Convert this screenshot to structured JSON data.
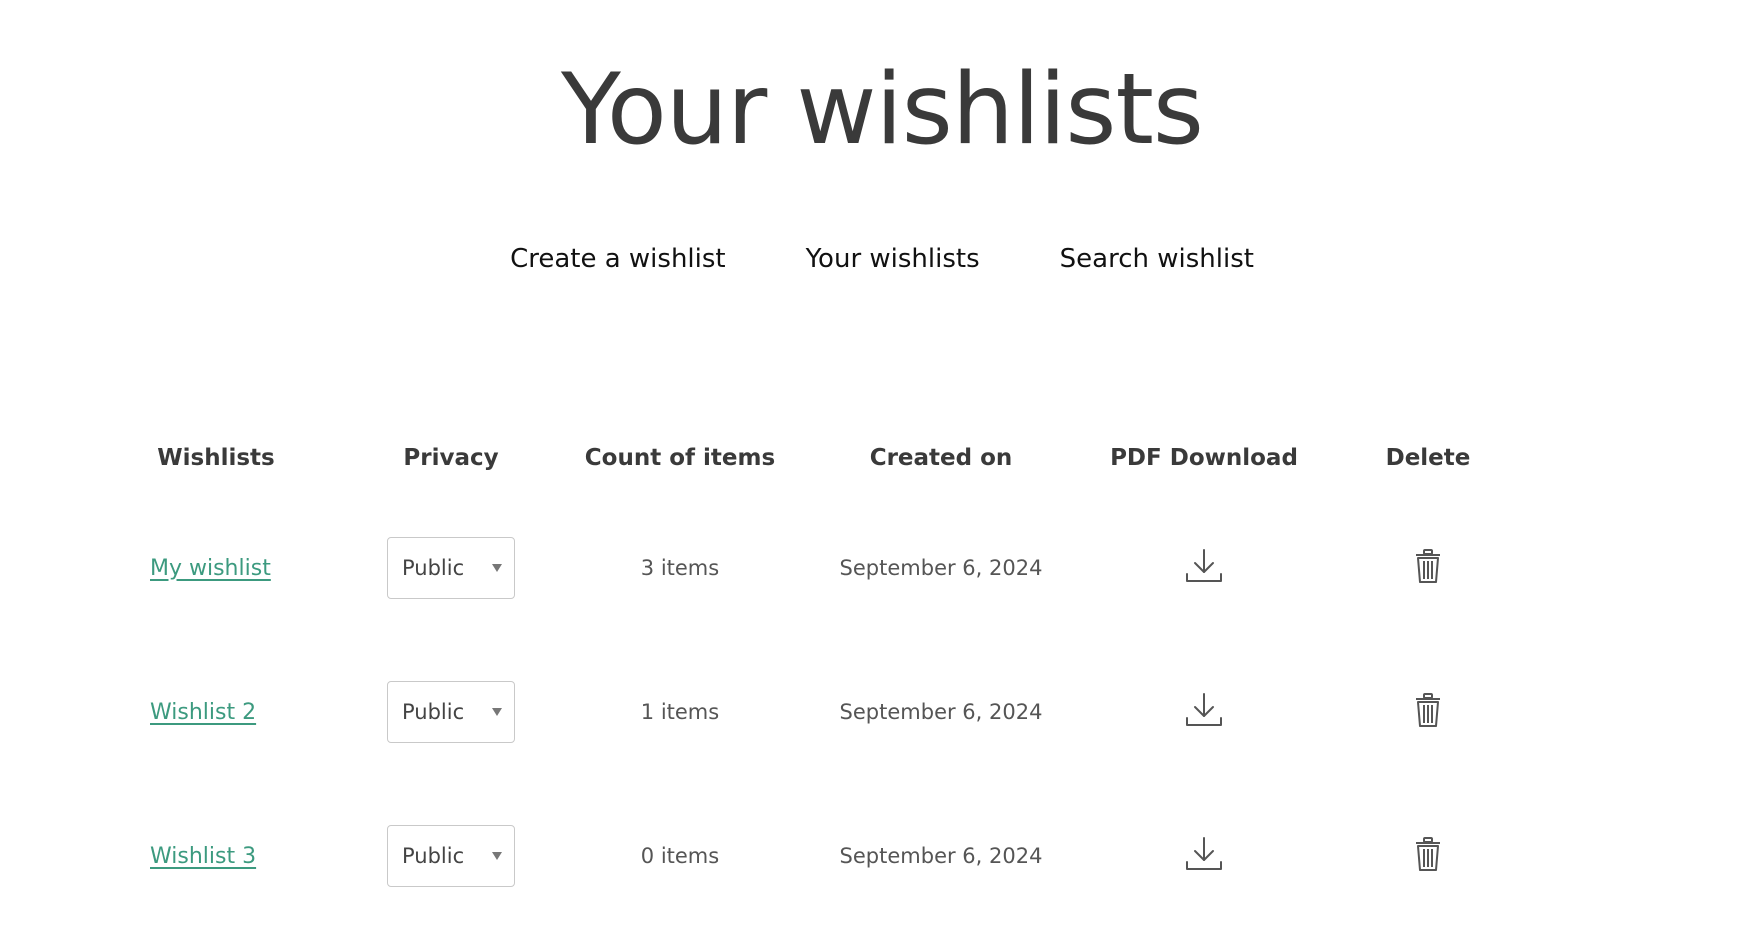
{
  "page": {
    "title": "Your wishlists"
  },
  "subnav": {
    "items": [
      {
        "label": "Create a wishlist"
      },
      {
        "label": "Your wishlists"
      },
      {
        "label": "Search wishlist"
      }
    ]
  },
  "table": {
    "headers": {
      "name": "Wishlists",
      "privacy": "Privacy",
      "count": "Count of items",
      "created": "Created on",
      "pdf": "PDF Download",
      "delete": "Delete"
    },
    "rows": [
      {
        "name": "My wishlist ",
        "privacy": "Public",
        "count": "3 items",
        "created": "September 6, 2024"
      },
      {
        "name": "Wishlist 2 ",
        "privacy": "Public",
        "count": "1 items",
        "created": "September 6, 2024"
      },
      {
        "name": "Wishlist 3 ",
        "privacy": "Public",
        "count": "0 items",
        "created": "September 6, 2024"
      }
    ]
  },
  "icons": {
    "pdf": "download-icon",
    "delete": "trash-icon",
    "select": "chevron-down-icon"
  },
  "colors": {
    "link": "#3c9a7f",
    "heading": "#3a3a3a",
    "border": "#c9c9c9"
  }
}
